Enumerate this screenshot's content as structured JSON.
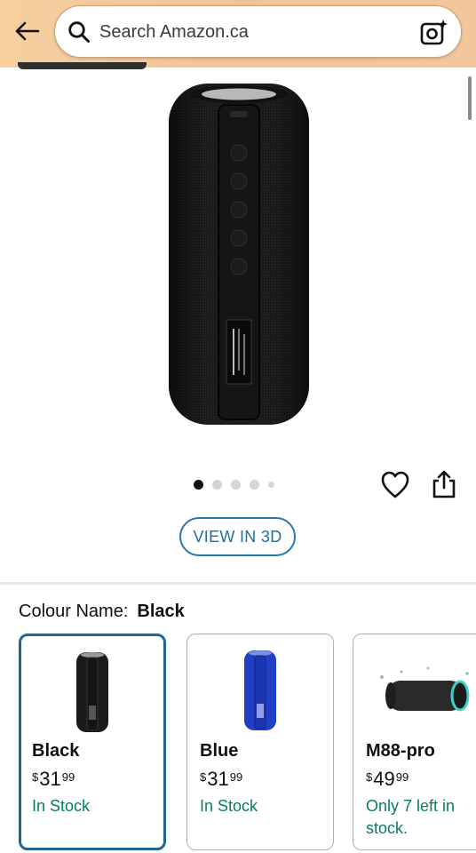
{
  "header": {
    "back_icon": "arrow-left-icon",
    "search_placeholder": "Search Amazon.ca",
    "search_icon": "search-icon",
    "camera_icon": "camera-search-icon"
  },
  "product": {
    "image_icon": "speaker-image",
    "carousel_count": 5,
    "carousel_active": 1,
    "wishlist_icon": "heart-icon",
    "share_icon": "share-icon",
    "view3d_label": "VIEW IN 3D"
  },
  "colour": {
    "label": "Colour Name:",
    "value": "Black"
  },
  "variants": [
    {
      "name": "Black",
      "currency": "$",
      "dollars": "31",
      "cents": "99",
      "stock": "In Stock",
      "color": "#1b1b1b",
      "selected": true
    },
    {
      "name": "Blue",
      "currency": "$",
      "dollars": "31",
      "cents": "99",
      "stock": "In Stock",
      "color": "#1f3fc4",
      "selected": false
    },
    {
      "name": "M88-pro",
      "currency": "$",
      "dollars": "49",
      "cents": "99",
      "stock": "Only 7 left in stock.",
      "color": "#2a2a2a",
      "selected": false
    }
  ],
  "colors": {
    "header_bg": "#f3c79c",
    "accent_blue": "#216693",
    "stock_green": "#067d62"
  }
}
